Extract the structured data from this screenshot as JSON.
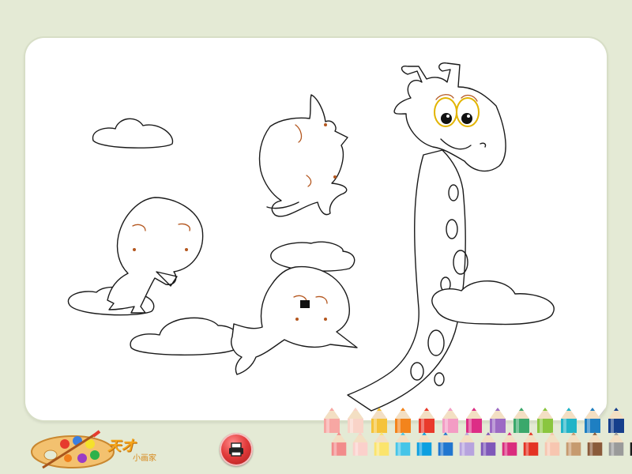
{
  "app": {
    "logo_text": "天才",
    "logo_subtext": "小画家"
  },
  "toolbar": {
    "print_icon": "printer-icon",
    "pencil_icon": "pencil-icon"
  },
  "palette": {
    "top_row": [
      "#f7a7a3",
      "#f9d3c7",
      "#f5c33a",
      "#f3841c",
      "#e93a2b",
      "#f39cc4",
      "#dd2e86",
      "#9c6ac4",
      "#3aa86b",
      "#8ac63f",
      "#21b4c7",
      "#1e7fc2",
      "#163f8c"
    ],
    "bottom_row": [
      "#f28b8b",
      "#fbd0cb",
      "#fbe46c",
      "#46c5e8",
      "#0c9fe0",
      "#2176cf",
      "#b7a3de",
      "#7f58b9",
      "#da2c7d",
      "#e43223",
      "#f7c6b0",
      "#c69a6f",
      "#8a5a3a",
      "#9a9a9a",
      "#1c1c1c"
    ]
  }
}
